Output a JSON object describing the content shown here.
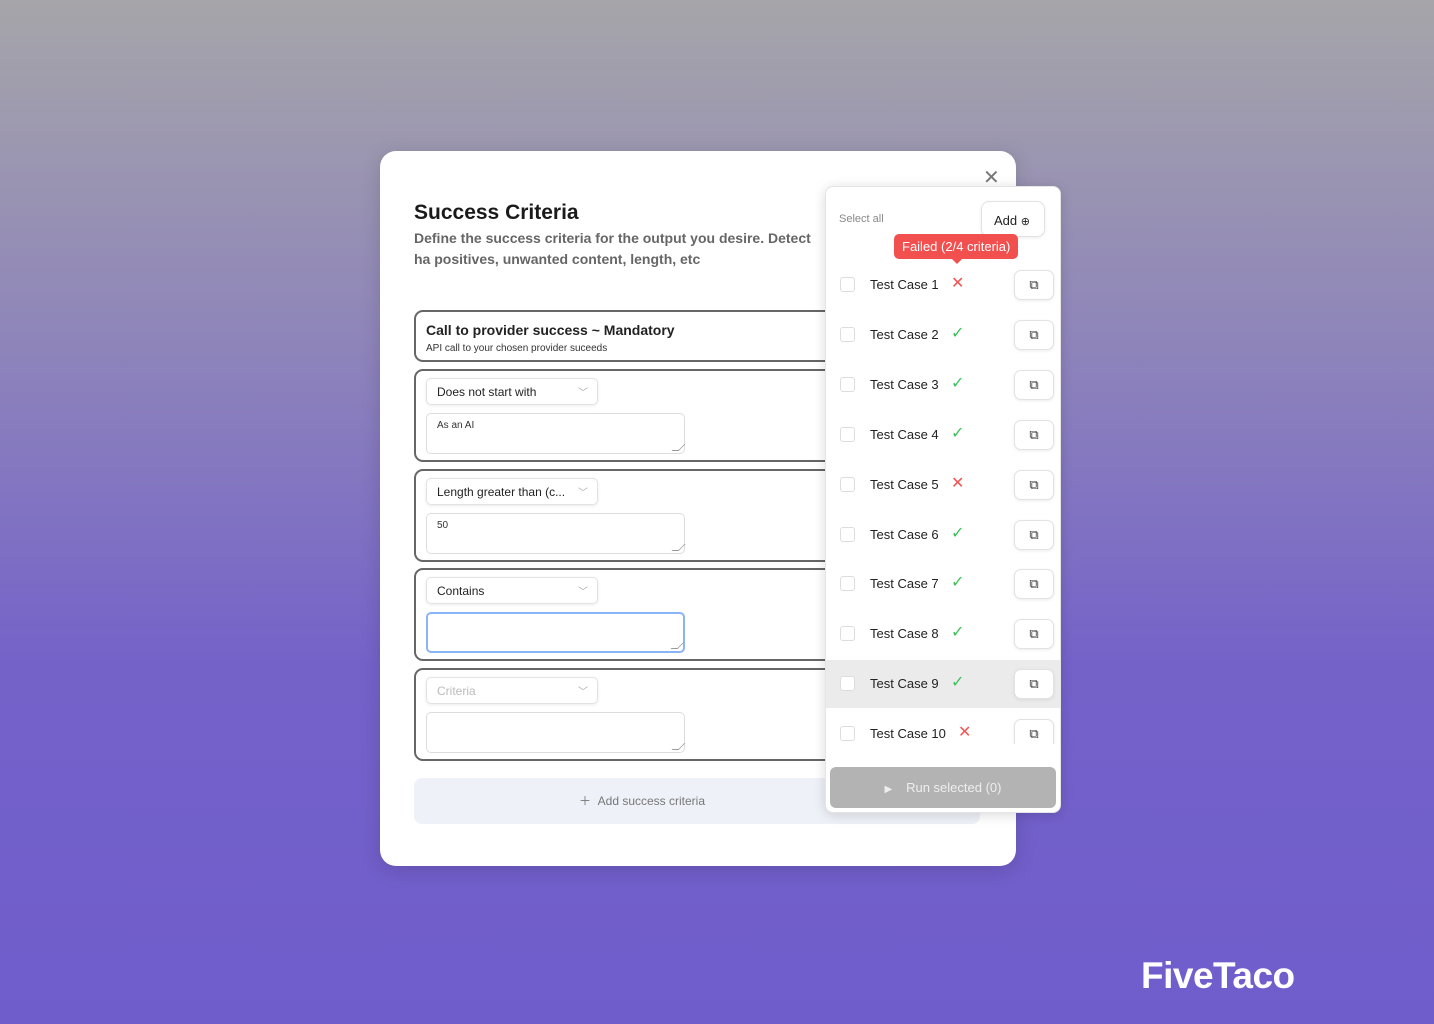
{
  "modal": {
    "title": "Success Criteria",
    "description": "Define the success criteria for the output you desire. Detect ha positives, unwanted content, length, etc",
    "close_icon": "close-icon",
    "mandatory": {
      "title": "Call to provider success ~ Mandatory",
      "subtitle": "API call to your chosen provider suceeds"
    },
    "criteria": [
      {
        "type": "Does not start with",
        "value": "As an AI",
        "placeholder": false
      },
      {
        "type": "Length greater than (c...",
        "value": "50",
        "placeholder": false
      },
      {
        "type": "Contains",
        "value": "",
        "placeholder": false,
        "focused": true
      },
      {
        "type": "Criteria",
        "value": "",
        "placeholder": true
      }
    ],
    "add_label": "Add success criteria"
  },
  "panel": {
    "select_all": "Select all",
    "add_label": "Add",
    "tooltip": "Failed (2/4 criteria)",
    "test_cases": [
      {
        "label": "Test Case 1",
        "status": "fail"
      },
      {
        "label": "Test Case 2",
        "status": "pass"
      },
      {
        "label": "Test Case 3",
        "status": "pass"
      },
      {
        "label": "Test Case 4",
        "status": "pass"
      },
      {
        "label": "Test Case 5",
        "status": "fail"
      },
      {
        "label": "Test Case 6",
        "status": "pass"
      },
      {
        "label": "Test Case 7",
        "status": "pass"
      },
      {
        "label": "Test Case 8",
        "status": "pass"
      },
      {
        "label": "Test Case 9",
        "status": "pass",
        "highlighted": true
      },
      {
        "label": "Test Case 10",
        "status": "fail"
      }
    ],
    "run_label": "Run selected (0)"
  },
  "brand": "FiveTaco",
  "colors": {
    "pass": "#3cc25a",
    "fail": "#f25555",
    "focus": "#8ab4f8"
  }
}
